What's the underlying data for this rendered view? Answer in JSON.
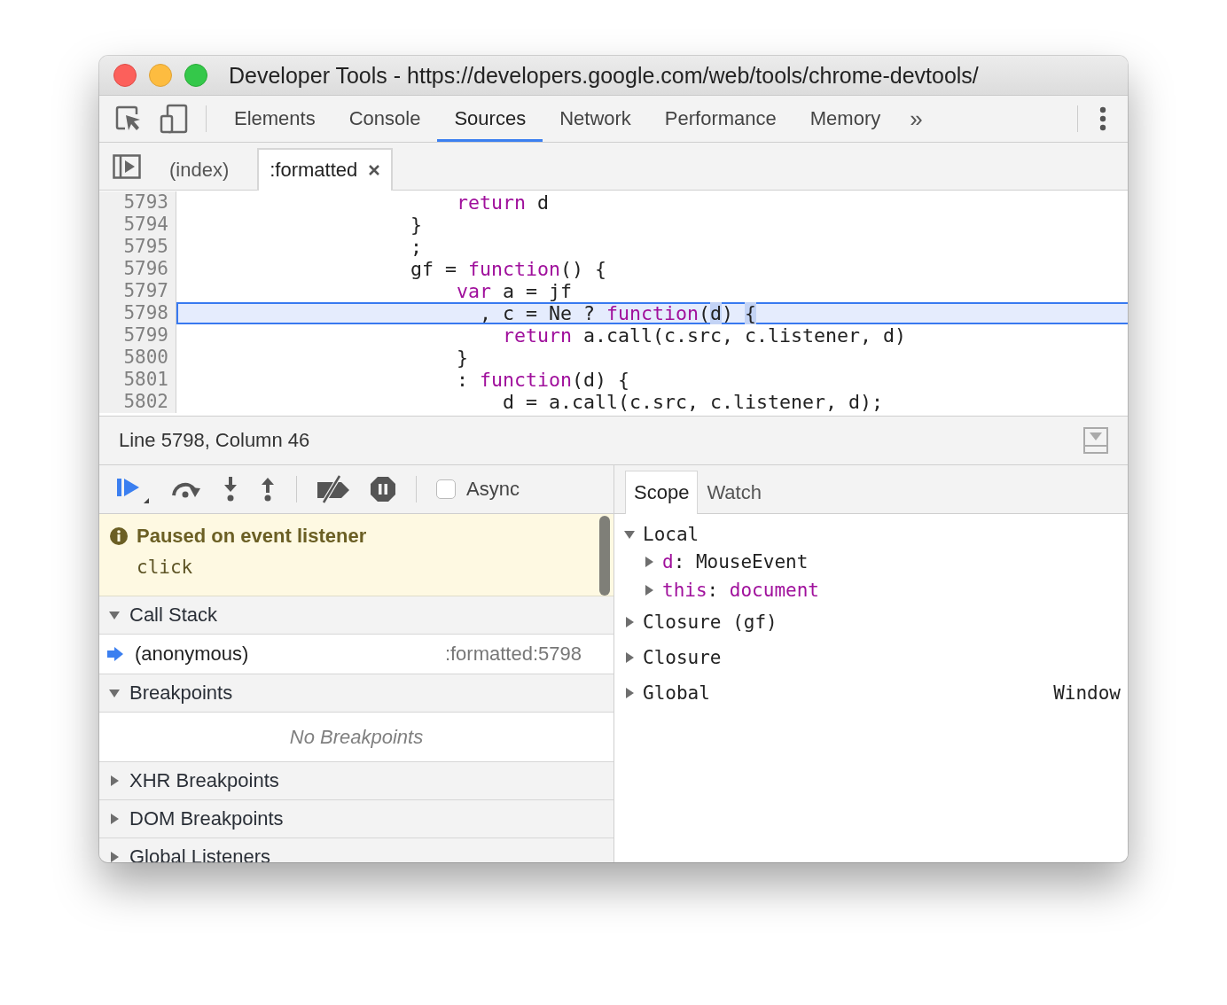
{
  "window": {
    "title": "Developer Tools - https://developers.google.com/web/tools/chrome-devtools/"
  },
  "main_tabs": [
    {
      "label": "Elements",
      "selected": false
    },
    {
      "label": "Console",
      "selected": false
    },
    {
      "label": "Sources",
      "selected": true
    },
    {
      "label": "Network",
      "selected": false
    },
    {
      "label": "Performance",
      "selected": false
    },
    {
      "label": "Memory",
      "selected": false
    }
  ],
  "more_tabs": "»",
  "file_tabs": [
    {
      "label": "(index)",
      "selected": false,
      "closable": false
    },
    {
      "label": ":formatted",
      "selected": true,
      "closable": true
    }
  ],
  "editor": {
    "lines": [
      {
        "number": "5793",
        "current": false,
        "segments": [
          {
            "text": "                        return",
            "kind": "keyword"
          },
          {
            "text": " d",
            "kind": "plain"
          }
        ]
      },
      {
        "number": "5794",
        "current": false,
        "segments": [
          {
            "text": "                    }",
            "kind": "plain"
          }
        ]
      },
      {
        "number": "5795",
        "current": false,
        "segments": [
          {
            "text": "                    ;",
            "kind": "plain"
          }
        ]
      },
      {
        "number": "5796",
        "current": false,
        "segments": [
          {
            "text": "                    gf = ",
            "kind": "plain"
          },
          {
            "text": "function",
            "kind": "keyword"
          },
          {
            "text": "() {",
            "kind": "plain"
          }
        ]
      },
      {
        "number": "5797",
        "current": false,
        "segments": [
          {
            "text": "                        var",
            "kind": "keyword"
          },
          {
            "text": " a = jf",
            "kind": "plain"
          }
        ]
      },
      {
        "number": "5798",
        "current": true,
        "segments": [
          {
            "text": "                          , c = Ne ? ",
            "kind": "plain"
          },
          {
            "text": "function",
            "kind": "keyword"
          },
          {
            "text": "(",
            "kind": "plain"
          },
          {
            "text": "d",
            "kind": "match"
          },
          {
            "text": ") ",
            "kind": "plain"
          },
          {
            "text": "{",
            "kind": "match"
          }
        ]
      },
      {
        "number": "5799",
        "current": false,
        "segments": [
          {
            "text": "                            return",
            "kind": "keyword"
          },
          {
            "text": " a.call(c.src, c.listener, d)",
            "kind": "plain"
          }
        ]
      },
      {
        "number": "5800",
        "current": false,
        "segments": [
          {
            "text": "                        }",
            "kind": "plain"
          }
        ]
      },
      {
        "number": "5801",
        "current": false,
        "segments": [
          {
            "text": "                        : ",
            "kind": "plain"
          },
          {
            "text": "function",
            "kind": "keyword"
          },
          {
            "text": "(d) {",
            "kind": "plain"
          }
        ]
      },
      {
        "number": "5802",
        "current": false,
        "segments": [
          {
            "text": "                            d = a.call(c.src, c.listener, d);",
            "kind": "plain"
          }
        ]
      }
    ]
  },
  "status_bar": {
    "position": "Line 5798, Column 46"
  },
  "async": {
    "label": "Async",
    "checked": false
  },
  "paused_banner": {
    "title": "Paused on event listener",
    "detail": "click"
  },
  "sections": [
    {
      "title": "Call Stack",
      "expanded": true,
      "frames": [
        {
          "name": "(anonymous)",
          "location": ":formatted:5798",
          "current": true
        }
      ]
    },
    {
      "title": "Breakpoints",
      "expanded": true,
      "empty_text": "No Breakpoints"
    },
    {
      "title": "XHR Breakpoints",
      "expanded": false
    },
    {
      "title": "DOM Breakpoints",
      "expanded": false
    },
    {
      "title": "Global Listeners",
      "expanded": false
    }
  ],
  "scope_tabs": [
    {
      "label": "Scope",
      "selected": true
    },
    {
      "label": "Watch",
      "selected": false
    }
  ],
  "scope": [
    {
      "label": "Local",
      "expanded": true,
      "children": [
        {
          "name": "d",
          "separator": ":",
          "value": "MouseEvent",
          "color": "#222222",
          "expanded": false
        },
        {
          "name": "this",
          "separator": ":",
          "value": "document",
          "color": "#a0109c",
          "expanded": false
        }
      ]
    },
    {
      "label": "Closure (gf)",
      "expanded": false
    },
    {
      "label": "Closure",
      "expanded": false
    },
    {
      "label": "Global",
      "expanded": false,
      "value": "Window"
    }
  ]
}
